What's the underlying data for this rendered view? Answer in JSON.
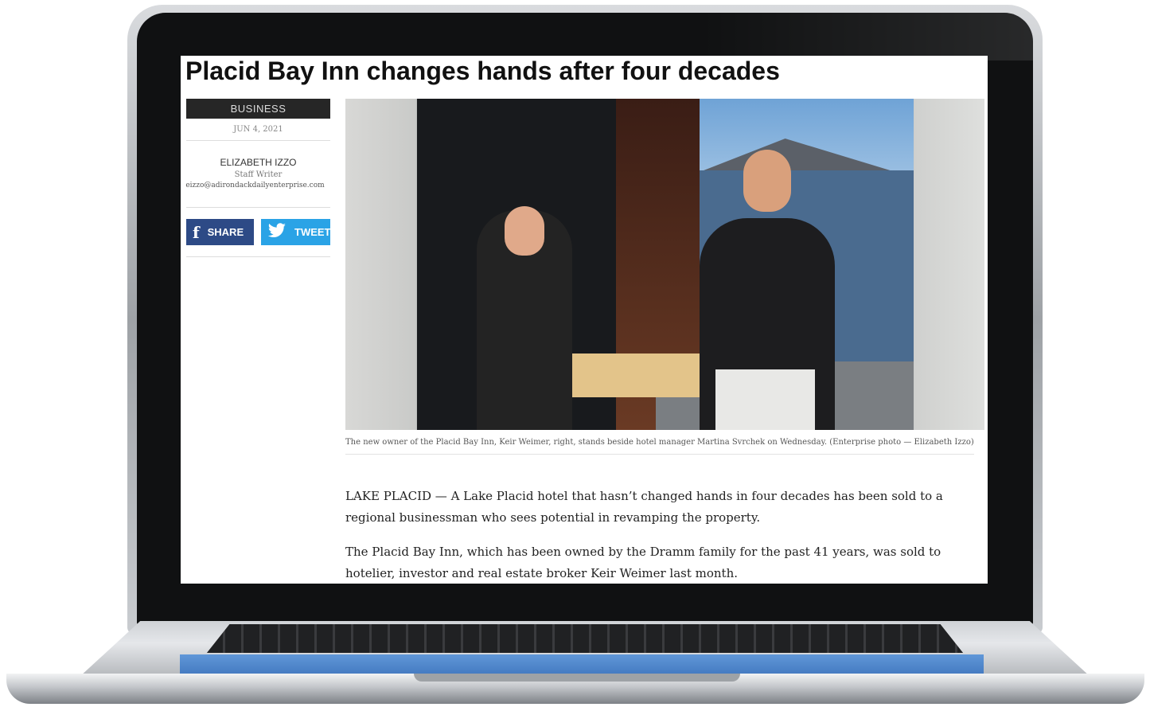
{
  "article": {
    "headline": "Placid Bay Inn changes hands after four decades",
    "section": "BUSINESS",
    "date": "JUN 4, 2021",
    "author": {
      "name": "ELIZABETH IZZO",
      "role": "Staff Writer",
      "email": "eizzo@adirondackdailyenterprise.com"
    },
    "share": {
      "facebook_label": "SHARE",
      "twitter_label": "TWEET"
    },
    "photo": {
      "caption": "The new owner of the Placid Bay Inn, Keir Weimer, right, stands beside hotel manager Martina Svrchek on Wednesday. (Enterprise photo — Elizabeth Izzo)"
    },
    "paragraphs": [
      "LAKE PLACID — A Lake Placid hotel that hasn’t changed hands in four decades has been sold to a regional businessman who sees potential in revamping the property.",
      "The Placid Bay Inn, which has been owned by the Dramm family for the past 41 years, was sold to hotelier, investor and real estate broker Keir Weimer last month."
    ]
  },
  "icons": {
    "facebook": "facebook-icon",
    "twitter": "twitter-icon"
  },
  "colors": {
    "facebook": "#2d4a86",
    "twitter": "#2aa3e6",
    "section_bg": "#262626"
  }
}
